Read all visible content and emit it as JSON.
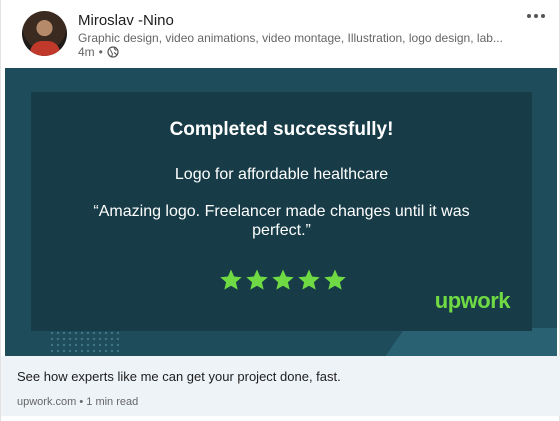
{
  "post": {
    "author_name": "Miroslav -Nino",
    "headline": "Graphic design, video animations, video montage, Illustration, logo design, lab...",
    "time": "4m",
    "separator": "•"
  },
  "banner": {
    "title": "Completed successfully!",
    "project": "Logo for affordable healthcare",
    "quote": "“Amazing logo. Freelancer made changes until it was perfect.”",
    "rating": 5,
    "brand": "upwork",
    "colors": {
      "background": "#1f4c5a",
      "panel": "#173c48",
      "stars": "#6fda44",
      "brand": "#6fda44"
    }
  },
  "link": {
    "title": "See how experts like me can get your project done, fast.",
    "source": "upwork.com",
    "separator": "•",
    "read_time": "1 min read"
  },
  "icons": {
    "visibility": "globe-icon",
    "menu": "more-options-icon",
    "rating": "star-icon"
  }
}
